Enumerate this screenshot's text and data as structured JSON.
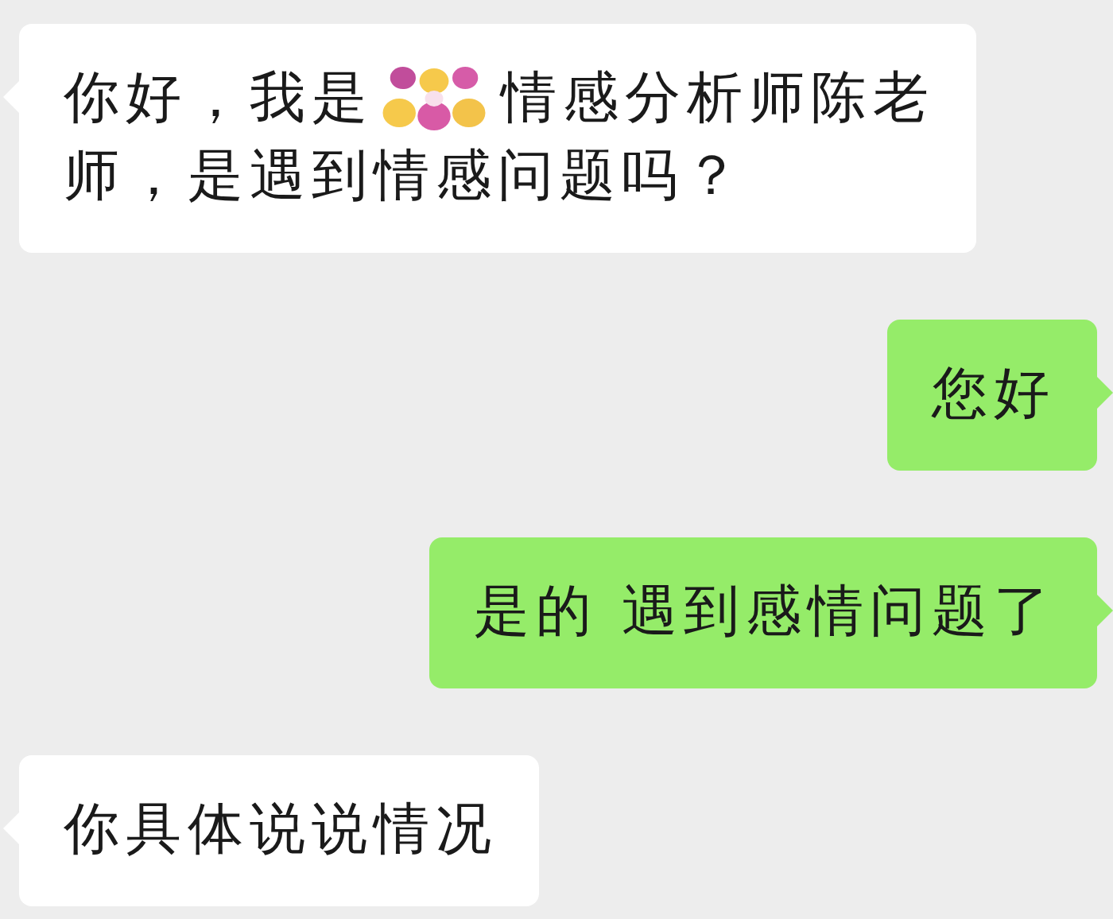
{
  "messages": [
    {
      "kind": "received",
      "lines": [
        [
          {
            "kind": "text",
            "text": "你好，我是"
          },
          {
            "kind": "sticker"
          },
          {
            "kind": "text",
            "text": "情感分析师陈老"
          }
        ],
        [
          {
            "kind": "text",
            "text": "师，是遇到情感问题吗？"
          }
        ]
      ]
    },
    {
      "kind": "sent",
      "lines": [
        [
          {
            "kind": "text",
            "text": "您好"
          }
        ]
      ]
    },
    {
      "kind": "sent",
      "lines": [
        [
          {
            "kind": "text",
            "text": "是的 遇到感情问题了"
          }
        ]
      ]
    },
    {
      "kind": "received",
      "lines": [
        [
          {
            "kind": "text",
            "text": "你具体说说情况"
          }
        ]
      ]
    }
  ]
}
